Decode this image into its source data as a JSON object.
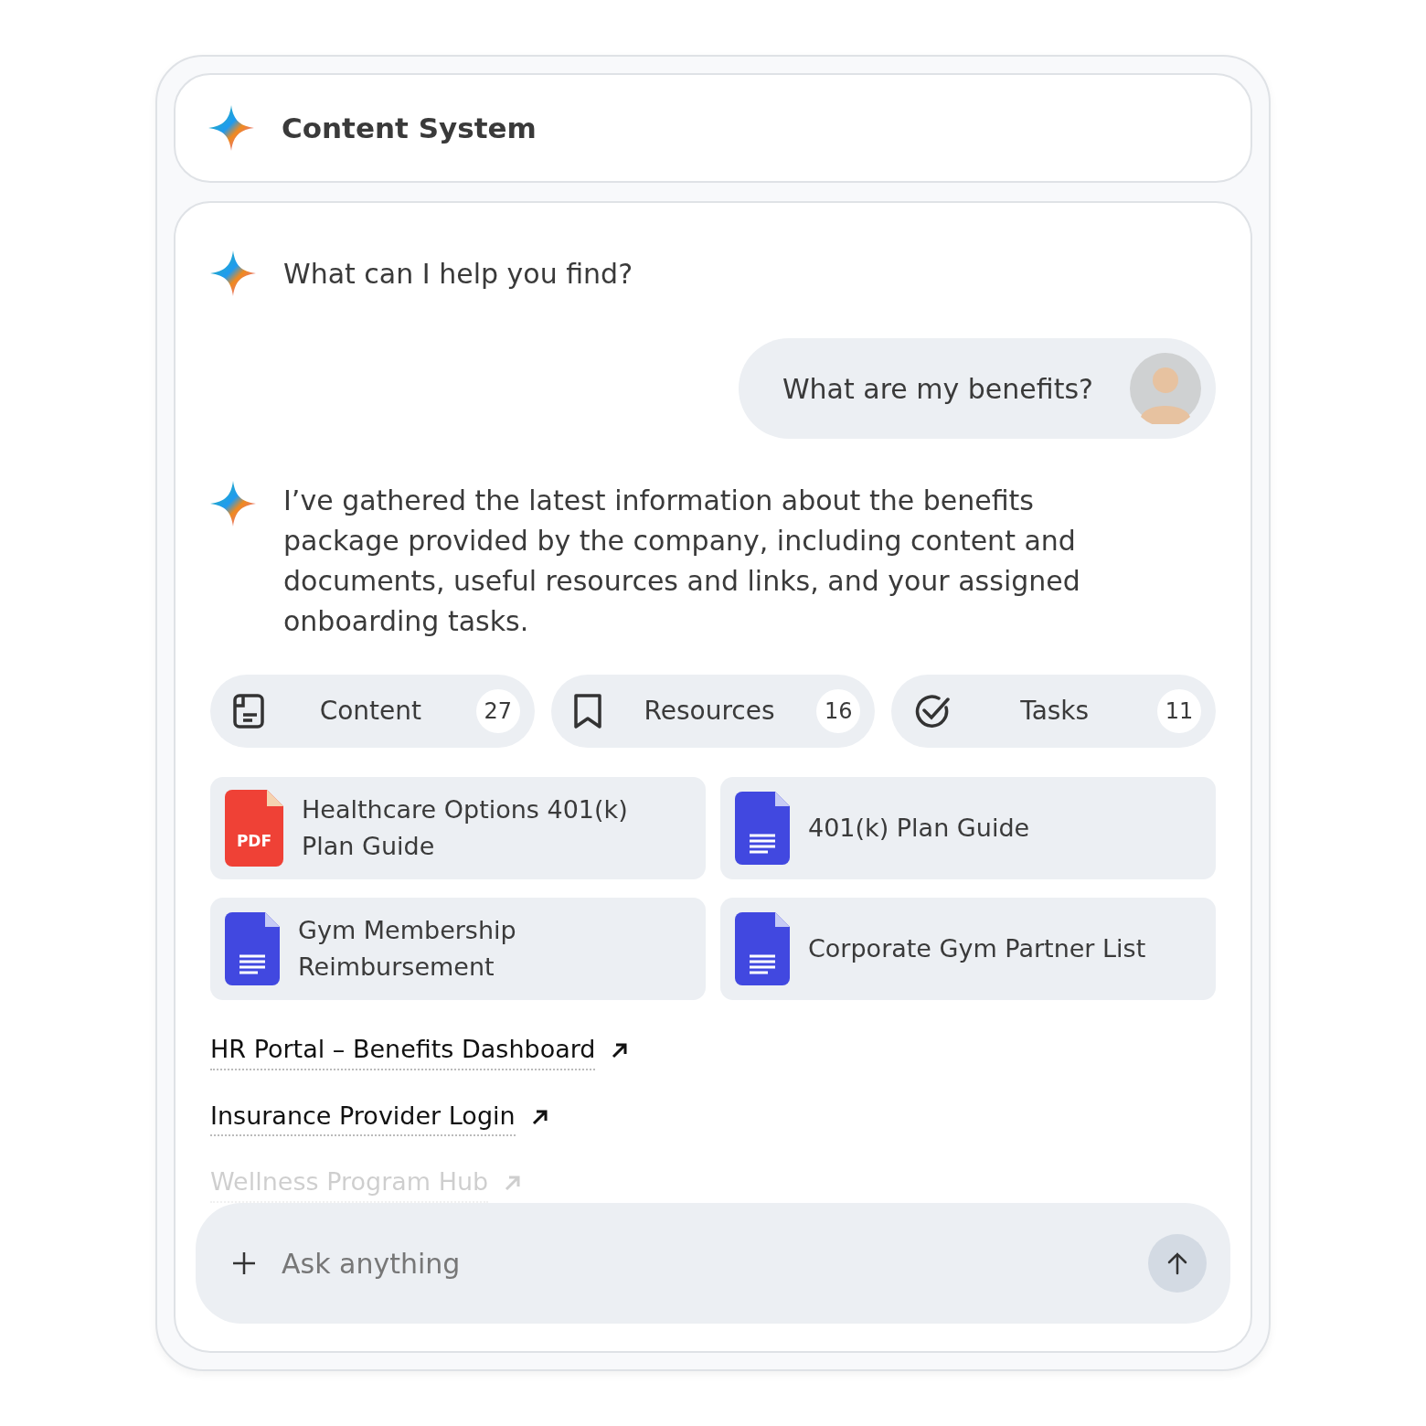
{
  "header": {
    "title": "Content System"
  },
  "greeting": "What can I help you find?",
  "user_message": {
    "text": "What are my benefits?"
  },
  "response": "I’ve gathered the latest information about the benefits package provided by the company, including content and documents, useful resources and links, and your assigned onboarding tasks.",
  "tabs": [
    {
      "kind": "content",
      "label": "Content",
      "count": "27"
    },
    {
      "kind": "resources",
      "label": "Resources",
      "count": "16"
    },
    {
      "kind": "tasks",
      "label": "Tasks",
      "count": "11"
    }
  ],
  "files": [
    {
      "kind": "pdf",
      "title": "Healthcare Options 401(k) Plan Guide",
      "badge": "PDF"
    },
    {
      "kind": "doc",
      "title": "401(k) Plan Guide"
    },
    {
      "kind": "doc",
      "title": "Gym Membership Reimbursement"
    },
    {
      "kind": "doc",
      "title": "Corporate Gym Partner List"
    }
  ],
  "links": [
    {
      "label": "HR Portal – Benefits Dashboard",
      "faded": false
    },
    {
      "label": "Insurance Provider Login",
      "faded": false
    },
    {
      "label": "Wellness Program Hub",
      "faded": true
    }
  ],
  "composer": {
    "placeholder": "Ask anything"
  }
}
